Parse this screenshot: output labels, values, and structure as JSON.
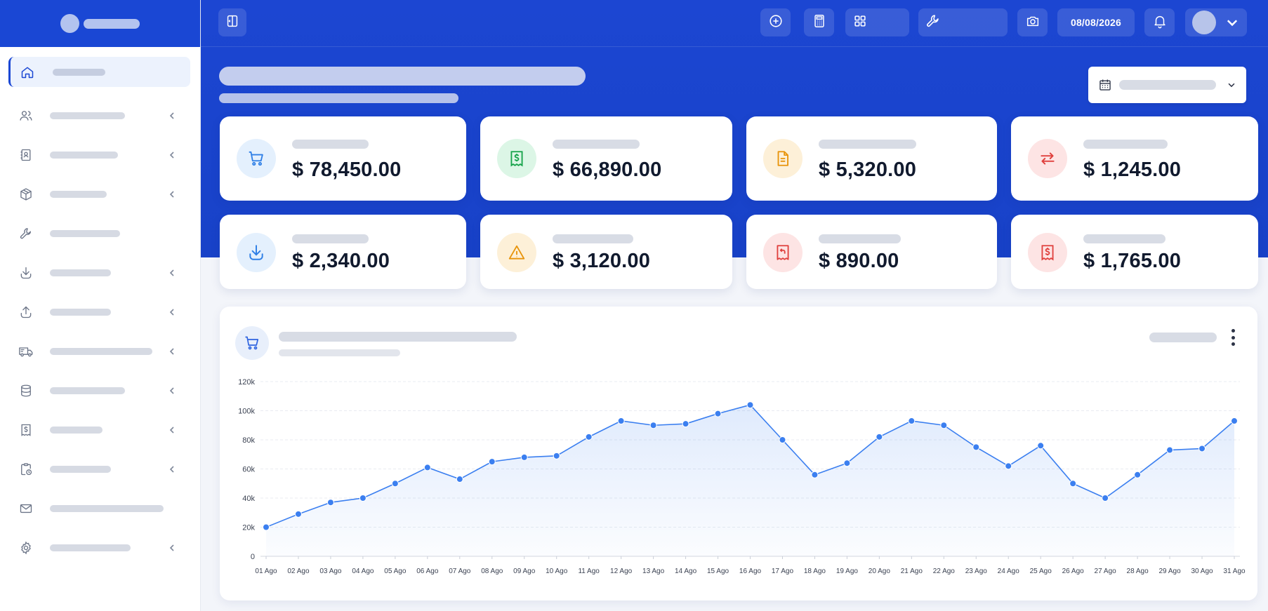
{
  "header": {
    "date": "08/08/2026"
  },
  "cards": [
    {
      "value": "$ 78,450.00",
      "icon": "shopping-cart-icon",
      "color": "#2f7fe6",
      "bg": "#e4f0fd"
    },
    {
      "value": "$ 66,890.00",
      "icon": "dollar-receipt-icon",
      "color": "#16a34a",
      "bg": "#dcf6e6"
    },
    {
      "value": "$ 5,320.00",
      "icon": "document-icon",
      "color": "#e8940b",
      "bg": "#fdf0d8"
    },
    {
      "value": "$ 1,245.00",
      "icon": "swap-arrows-icon",
      "color": "#e0413e",
      "bg": "#fde4e4"
    },
    {
      "value": "$ 2,340.00",
      "icon": "download-icon",
      "color": "#2f7fe6",
      "bg": "#e4f0fd"
    },
    {
      "value": "$ 3,120.00",
      "icon": "warning-icon",
      "color": "#e8940b",
      "bg": "#fdf0d8"
    },
    {
      "value": "$ 890.00",
      "icon": "return-receipt-icon",
      "color": "#e0413e",
      "bg": "#fde4e4"
    },
    {
      "value": "$ 1,765.00",
      "icon": "dollar-receipt-icon",
      "color": "#e0413e",
      "bg": "#fde4e4"
    }
  ],
  "chart_data": {
    "type": "area",
    "title": "",
    "xlabel": "",
    "ylabel": "",
    "ylim": [
      0,
      120000
    ],
    "yticks": [
      0,
      20000,
      40000,
      60000,
      80000,
      100000,
      120000
    ],
    "yticklabels": [
      "0",
      "20k",
      "40k",
      "60k",
      "80k",
      "100k",
      "120k"
    ],
    "grid": true,
    "categories": [
      "01 Ago",
      "02 Ago",
      "03 Ago",
      "04 Ago",
      "05 Ago",
      "06 Ago",
      "07 Ago",
      "08 Ago",
      "09 Ago",
      "10 Ago",
      "11 Ago",
      "12 Ago",
      "13 Ago",
      "14 Ago",
      "15 Ago",
      "16 Ago",
      "17 Ago",
      "18 Ago",
      "19 Ago",
      "20 Ago",
      "21 Ago",
      "22 Ago",
      "23 Ago",
      "24 Ago",
      "25 Ago",
      "26 Ago",
      "27 Ago",
      "28 Ago",
      "29 Ago",
      "30 Ago",
      "31 Ago"
    ],
    "values": [
      20000,
      29000,
      37000,
      40000,
      50000,
      61000,
      53000,
      65000,
      68000,
      69000,
      82000,
      93000,
      90000,
      91000,
      98000,
      104000,
      80000,
      56000,
      64000,
      82000,
      93000,
      90000,
      75000,
      62000,
      76000,
      50000,
      40000,
      56000,
      73000,
      74000,
      93000
    ],
    "color": "#3b7ff0"
  }
}
